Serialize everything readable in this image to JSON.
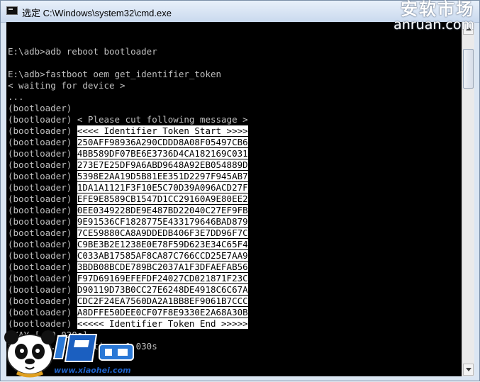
{
  "window": {
    "title": "选定 C:\\Windows\\system32\\cmd.exe"
  },
  "watermark_top": {
    "cn": "安软市场",
    "en": "anruan.com"
  },
  "watermark_logo": {
    "text": "www.xiaohei.com"
  },
  "console": {
    "lines": [
      {
        "text": ""
      },
      {
        "text": "E:\\adb>adb reboot bootloader"
      },
      {
        "text": ""
      },
      {
        "text": "E:\\adb>fastboot oem get_identifier_token"
      },
      {
        "text": "< waiting for device >"
      },
      {
        "text": "..."
      },
      {
        "text": "(bootloader)"
      },
      {
        "prefix": "(bootloader) ",
        "text": "< Please cut following message >"
      },
      {
        "prefix": "(bootloader) ",
        "text": "<<<< Identifier Token Start >>>>",
        "highlight": true
      },
      {
        "prefix": "(bootloader) ",
        "text": "250AFF98936A290CDDD8A08F05497CB6",
        "highlight": true
      },
      {
        "prefix": "(bootloader) ",
        "text": "4BB589DF07BE6E3736D4CA182169C031",
        "highlight": true
      },
      {
        "prefix": "(bootloader) ",
        "text": "273E7E25DF9A6ABD9648A92EB054889D",
        "highlight": true
      },
      {
        "prefix": "(bootloader) ",
        "text": "5398E2AA19D5B81EE351D2297F945AB7",
        "highlight": true
      },
      {
        "prefix": "(bootloader) ",
        "text": "1DA1A1121F3F10E5C70D39A096ACD27F",
        "highlight": true
      },
      {
        "prefix": "(bootloader) ",
        "text": "EFE9E8589CB1547D1CC29160A9E80EE2",
        "highlight": true
      },
      {
        "prefix": "(bootloader) ",
        "text": "0EE0349228DE9E487BD22040C27EF9FB",
        "highlight": true
      },
      {
        "prefix": "(bootloader) ",
        "text": "9E91536CF1828775E433179646BAD879",
        "highlight": true
      },
      {
        "prefix": "(bootloader) ",
        "text": "7CE59880CA8A9DDEDB406F3E7DD96F7C",
        "highlight": true
      },
      {
        "prefix": "(bootloader) ",
        "text": "C9BE3B2E1238E0E78F59D623E34C65F4",
        "highlight": true
      },
      {
        "prefix": "(bootloader) ",
        "text": "C033AB17585AF8CA87C766CCD25E7AA9",
        "highlight": true
      },
      {
        "prefix": "(bootloader) ",
        "text": "3BDB08BCDE789BC2037A1F3DFAEFAB56",
        "highlight": true
      },
      {
        "prefix": "(bootloader) ",
        "text": "F97D69169EFEFDF24027CD021871F23C",
        "highlight": true
      },
      {
        "prefix": "(bootloader) ",
        "text": "D90119D73B0CC27E6248DE4918C6C67A",
        "highlight": true
      },
      {
        "prefix": "(bootloader) ",
        "text": "CDC2F24EA7560DA2A1BB8EF9061B7CCC",
        "highlight": true
      },
      {
        "prefix": "(bootloader) ",
        "text": "A8DFFE50DEE0CF07F8E9330E2A68A30B",
        "highlight": true
      },
      {
        "prefix": "(bootloader) ",
        "text": "<<<<< Identifier Token End >>>>>",
        "highlight": true
      },
      {
        "text": "OKAY [  0.020s]"
      },
      {
        "text": "finished. total time: 0.030s"
      }
    ]
  },
  "colors": {
    "console_bg": "#000000",
    "console_fg": "#c0c0c0",
    "selection_bg": "#ffffff",
    "selection_fg": "#000000"
  }
}
